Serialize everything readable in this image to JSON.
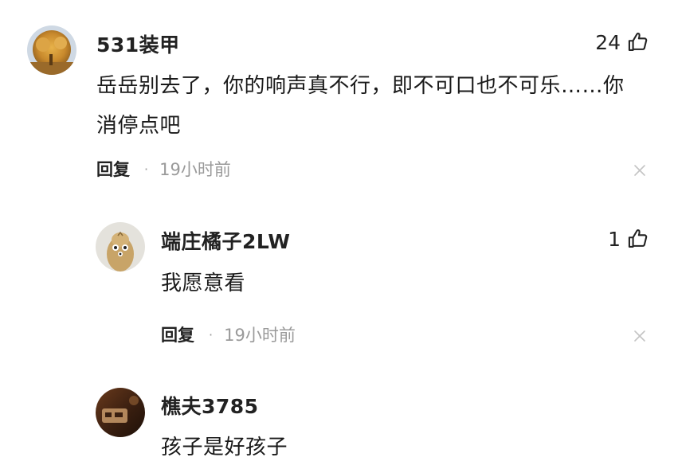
{
  "comments": [
    {
      "username": "531装甲",
      "likes": "24",
      "lines": [
        "岳岳别去了，你的响声真不行，即不可口也不可乐……你",
        "消停点吧"
      ],
      "reply_label": "回复",
      "separator": "·",
      "time": "19小时前"
    },
    {
      "username": "端庄橘子2LW",
      "likes": "1",
      "lines": [
        "我愿意看"
      ],
      "reply_label": "回复",
      "separator": "·",
      "time": "19小时前"
    },
    {
      "username": "樵夫3785",
      "lines": [
        "孩子是好孩子"
      ]
    }
  ],
  "colors": {
    "text": "#1a1a1a",
    "meta": "#9a9a9a",
    "close": "#c4c4c4"
  },
  "icons": [
    "avatar",
    "thumbs-up-icon",
    "close-icon"
  ]
}
